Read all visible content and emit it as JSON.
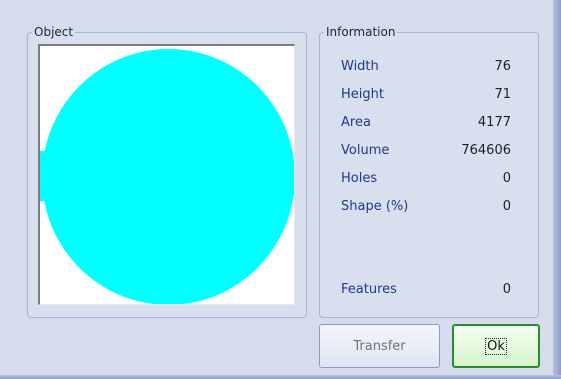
{
  "object_panel": {
    "title": "Object"
  },
  "info_panel": {
    "title": "Information",
    "rows": [
      {
        "label": "Width",
        "value": "76"
      },
      {
        "label": "Height",
        "value": "71"
      },
      {
        "label": "Area",
        "value": "4177"
      },
      {
        "label": "Volume",
        "value": "764606"
      },
      {
        "label": "Holes",
        "value": "0"
      },
      {
        "label": "Shape (%)",
        "value": "0"
      },
      {
        "label": "Features",
        "value": "0"
      }
    ]
  },
  "buttons": {
    "transfer": "Transfer",
    "ok": "Ok"
  },
  "colors": {
    "object_fill": "#00ffff",
    "label_text": "#1e3a8a",
    "ok_border": "#2f8a2f"
  }
}
